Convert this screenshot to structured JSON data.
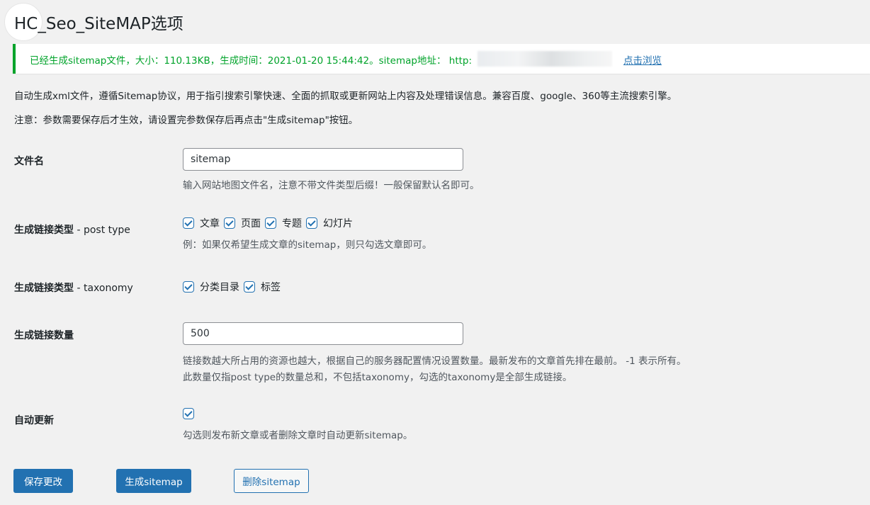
{
  "header": {
    "title": "HC_Seo_SiteMAP选项"
  },
  "notice": {
    "text": "已经生成sitemap文件，大小：110.13KB，生成时间：2021-01-20 15:44:42。sitemap地址： http:",
    "link_label": "点击浏览"
  },
  "intro": {
    "line1": "自动生成xml文件，遵循Sitemap协议，用于指引搜索引擎快速、全面的抓取或更新网站上内容及处理错误信息。兼容百度、google、360等主流搜索引擎。",
    "line2": "注意：参数需要保存后才生效，请设置完参数保存后再点击\"生成sitemap\"按钮。"
  },
  "fields": {
    "filename": {
      "label": "文件名",
      "value": "sitemap",
      "help": "输入网站地图文件名，注意不带文件类型后缀！一般保留默认名即可。"
    },
    "post_type": {
      "label_strong": "生成链接类型",
      "label_light": " - post type",
      "options": [
        "文章",
        "页面",
        "专题",
        "幻灯片"
      ],
      "help": "例：如果仅希望生成文章的sitemap，则只勾选文章即可。"
    },
    "taxonomy": {
      "label_strong": "生成链接类型",
      "label_light": " - taxonomy",
      "options": [
        "分类目录",
        "标签"
      ]
    },
    "count": {
      "label": "生成链接数量",
      "value": "500",
      "help1": "链接数越大所占用的资源也越大，根据自己的服务器配置情况设置数量。最新发布的文章首先排在最前。 -1 表示所有。",
      "help2": "此数量仅指post type的数量总和，不包括taxonomy，勾选的taxonomy是全部生成链接。"
    },
    "auto_update": {
      "label": "自动更新",
      "help": "勾选则发布新文章或者删除文章时自动更新sitemap。"
    }
  },
  "buttons": {
    "save": "保存更改",
    "generate": "生成sitemap",
    "delete": "删除sitemap"
  },
  "colors": {
    "accent": "#2271b1",
    "success": "#00a32a"
  }
}
